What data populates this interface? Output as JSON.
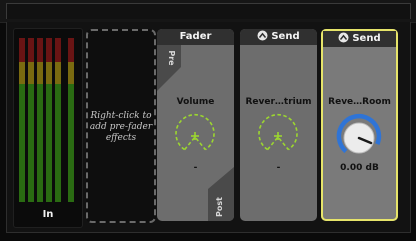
{
  "meter": {
    "label": "In"
  },
  "placeholder": {
    "text": "Right-click to add pre-fader effects"
  },
  "modules": [
    {
      "title": "Fader",
      "param_name": "Volume",
      "param_value": "-",
      "tags": {
        "pre": "Pre",
        "post": "Post"
      }
    },
    {
      "title": "Send",
      "param_name": "Rever…trium",
      "param_value": "-"
    },
    {
      "title": "Send",
      "param_name": "Reve…Room",
      "param_value": "0.00 dB"
    }
  ],
  "colors": {
    "selected_outline": "#e6e46a",
    "knob_empty": "#9cd630",
    "knob_active": "#2f74d6"
  }
}
